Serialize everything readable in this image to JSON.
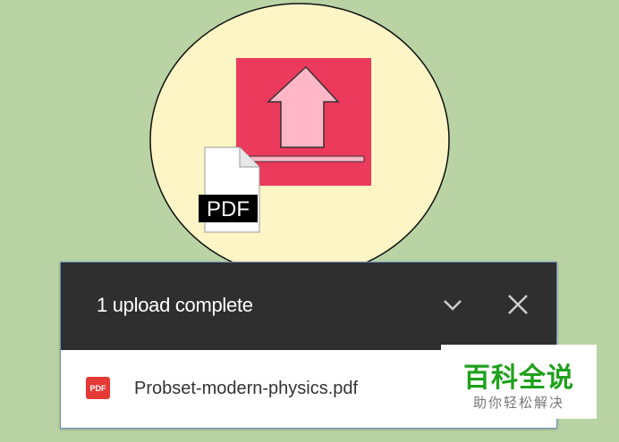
{
  "illustration": {
    "pdf_badge": "PDF",
    "colors": {
      "circle": "#fdf5c6",
      "upload_square": "#ec3a5c",
      "arrow": "#ffb7c8",
      "badge": "#000000"
    },
    "icons": [
      "upload-arrow-icon",
      "pdf-document-icon"
    ]
  },
  "upload_panel": {
    "title": "1 upload complete",
    "collapse_icon": "chevron-down-icon",
    "close_icon": "close-icon",
    "files": [
      {
        "icon": "pdf-file-icon",
        "icon_text": "PDF",
        "name": "Probset-modern-physics.pdf"
      }
    ]
  },
  "watermark": {
    "main": "百科全说",
    "sub": "助你轻松解决"
  }
}
